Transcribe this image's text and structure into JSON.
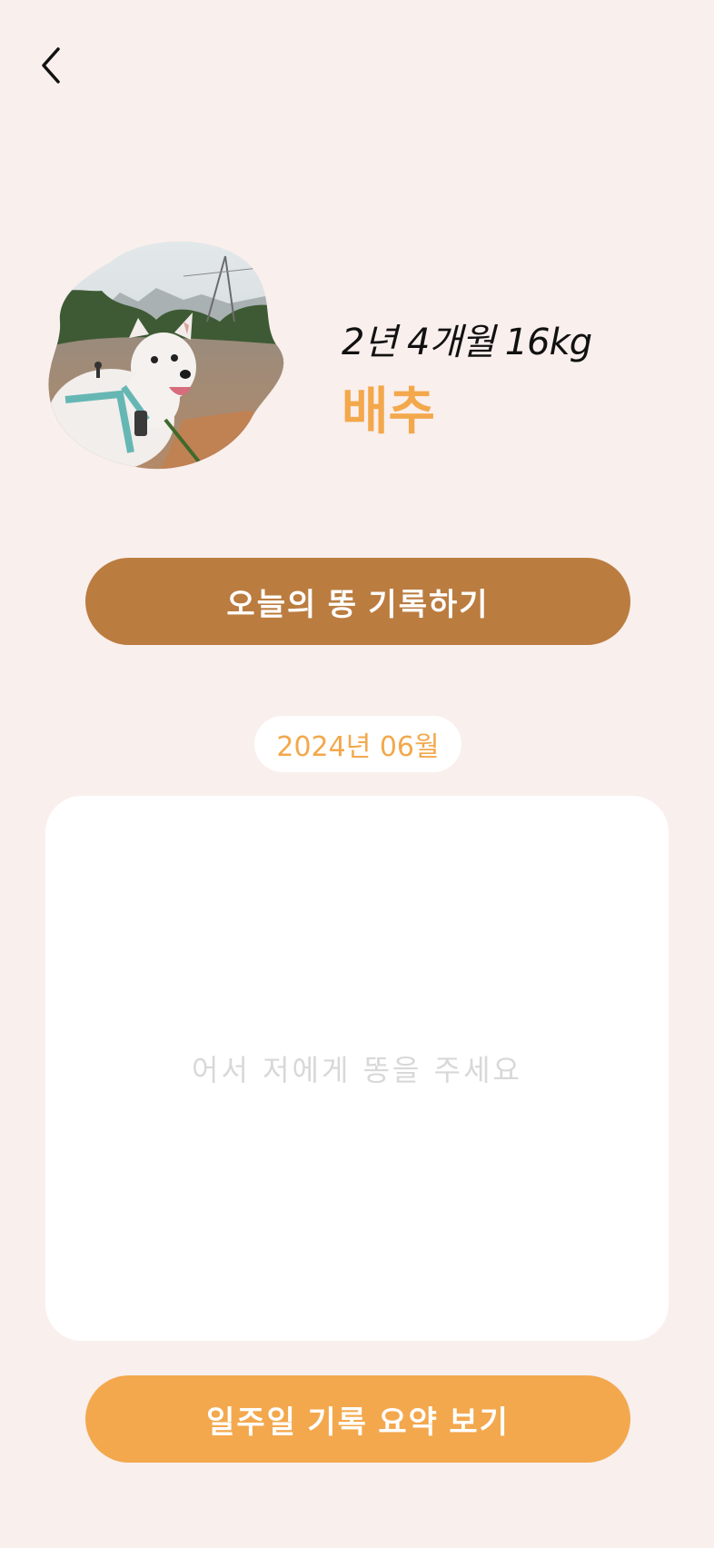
{
  "header": {
    "back_icon": "chevron-left-icon"
  },
  "profile": {
    "age_weight": "2년 4개월 16kg",
    "name": "배추",
    "photo_description": "dog-photo"
  },
  "actions": {
    "record_today_label": "오늘의 똥 기록하기",
    "weekly_summary_label": "일주일 기록 요약 보기"
  },
  "calendar": {
    "month_label": "2024년 06월",
    "empty_message": "어서 저에게 똥을 주세요"
  },
  "colors": {
    "background": "#f9efed",
    "accent_orange": "#f3a84c",
    "brown_button": "#bb7c40",
    "card": "#ffffff"
  }
}
